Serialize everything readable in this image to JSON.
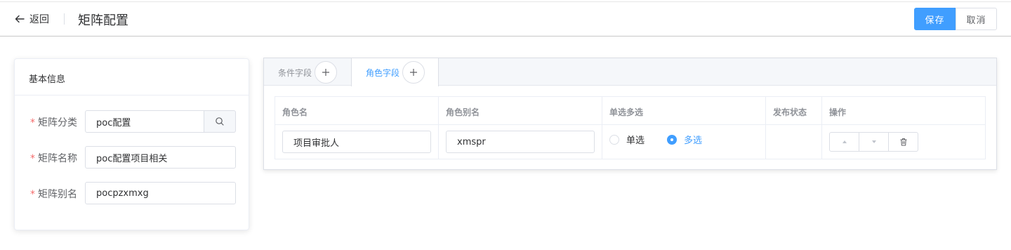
{
  "header": {
    "back_label": "返回",
    "title": "矩阵配置",
    "save_label": "保存",
    "cancel_label": "取消"
  },
  "basic_info": {
    "title": "基本信息",
    "fields": [
      {
        "label": "矩阵分类",
        "value": "poc配置",
        "required": true
      },
      {
        "label": "矩阵名称",
        "value": "poc配置项目相关",
        "required": true
      },
      {
        "label": "矩阵别名",
        "value": "pocpzxmxg",
        "required": true
      }
    ]
  },
  "tabs": [
    {
      "label": "条件字段",
      "active": false
    },
    {
      "label": "角色字段",
      "active": true
    }
  ],
  "table": {
    "columns": [
      "角色名",
      "角色别名",
      "单选多选",
      "发布状态",
      "操作"
    ],
    "rows": [
      {
        "role_name": "项目审批人",
        "role_alias": "xmspr",
        "select_options": [
          "单选",
          "多选"
        ],
        "selected": "多选",
        "publish_status": ""
      }
    ]
  },
  "icons": {
    "back": "arrow-left-icon",
    "search": "search-icon",
    "add": "plus-icon",
    "up": "caret-up-icon",
    "down": "caret-down-icon",
    "delete": "trash-icon"
  },
  "colors": {
    "primary": "#409eff",
    "required": "#f56c6c",
    "text": "#303133",
    "border": "#dcdfe6"
  }
}
